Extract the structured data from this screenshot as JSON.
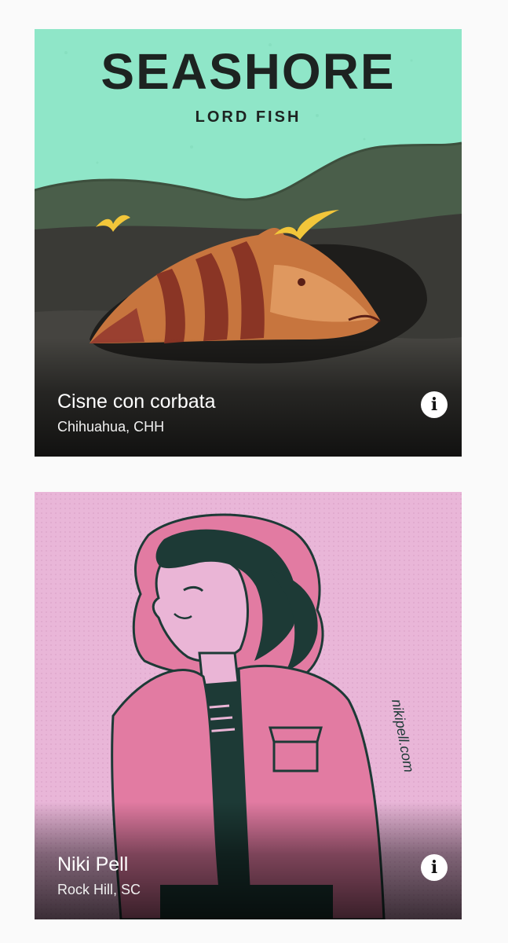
{
  "cards": [
    {
      "artwork": {
        "title_text": "SEASHORE",
        "subtitle_text": "LORD FISH",
        "background": "#8de8c8"
      },
      "title": "Cisne con corbata",
      "location": "Chihuahua, CHH",
      "info_icon": "info-icon"
    },
    {
      "artwork": {
        "signature_text": "nikipell.com",
        "background": "#e9b6d8"
      },
      "title": "Niki Pell",
      "location": "Rock Hill, SC",
      "info_icon": "info-icon"
    }
  ]
}
